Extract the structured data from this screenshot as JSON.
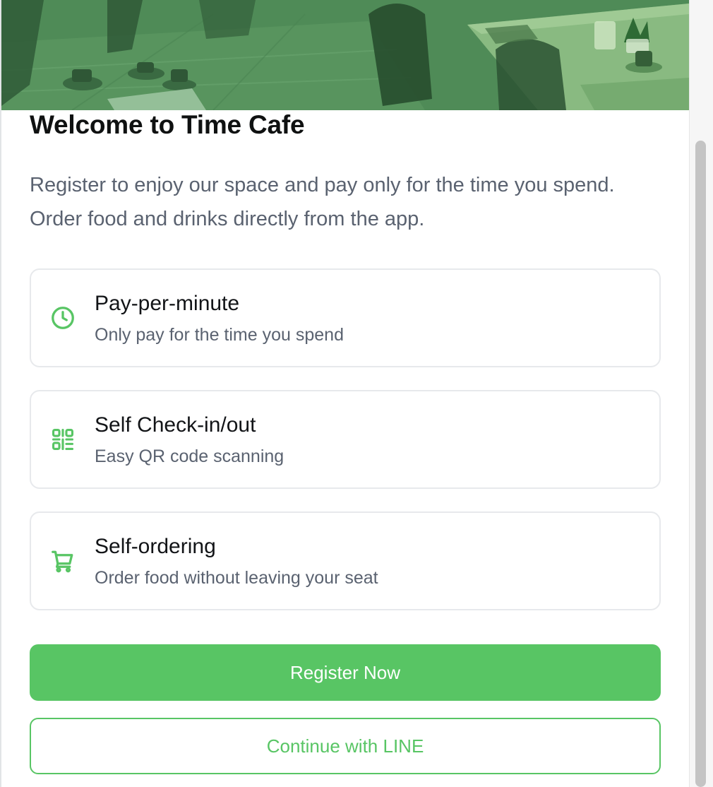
{
  "hero": {
    "image": "cafe-interior-photo"
  },
  "welcome": {
    "title": "Welcome to Time Cafe",
    "description": "Register to enjoy our space and pay only for the time you spend. Order food and drinks directly from the app."
  },
  "features": [
    {
      "icon": "clock-icon",
      "title": "Pay-per-minute",
      "description": "Only pay for the time you spend"
    },
    {
      "icon": "qr-code-icon",
      "title": "Self Check-in/out",
      "description": "Easy QR code scanning"
    },
    {
      "icon": "cart-icon",
      "title": "Self-ordering",
      "description": "Order food without leaving your seat"
    }
  ],
  "actions": {
    "register_label": "Register Now",
    "line_label": "Continue with LINE"
  },
  "colors": {
    "accent": "#58c564",
    "text_primary": "#0f1111",
    "text_secondary": "#5a6270",
    "card_border": "#e7e9ec"
  }
}
